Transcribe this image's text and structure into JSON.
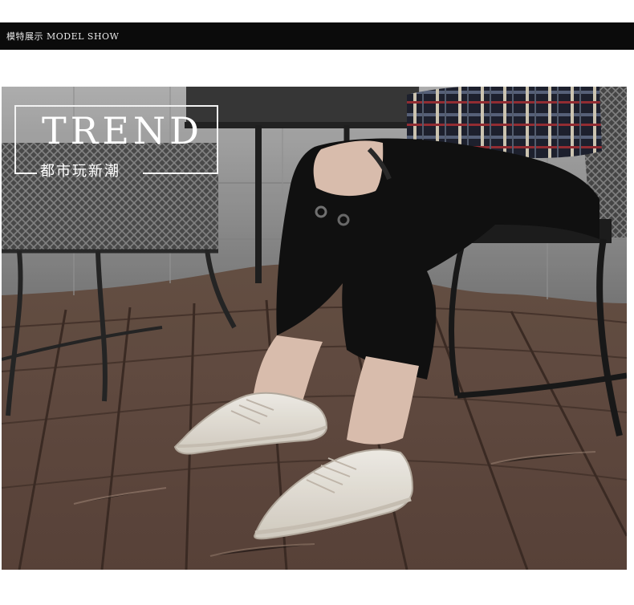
{
  "section_header": {
    "title": "模特展示 MODEL SHOW"
  },
  "hero": {
    "headline": "TREND",
    "subheadline": "都市玩新潮"
  },
  "colors": {
    "header_bar": "#0b0b0b",
    "header_text": "#e9e9e9",
    "overlay_text": "#ffffff",
    "deck_wood": "#6a5448",
    "shoe_white": "#f3efe7",
    "pants_black": "#111111"
  }
}
